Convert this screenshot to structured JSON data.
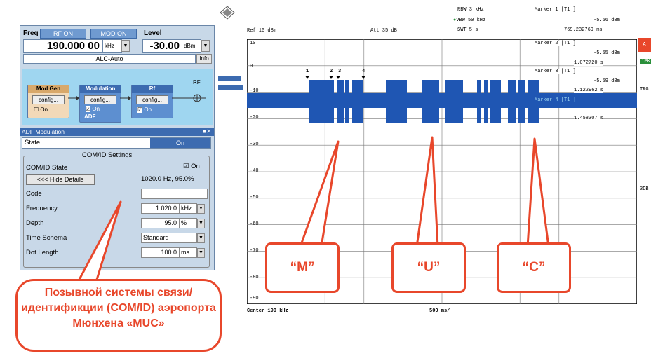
{
  "generator": {
    "freq_label": "Freq",
    "rf_on": "RF ON",
    "mod_on": "MOD ON",
    "level_label": "Level",
    "freq_value": "190.000 00",
    "freq_unit": "kHz",
    "level_value": "-30.00",
    "level_unit": "dBm",
    "alc": "ALC-Auto",
    "info": "Info",
    "blocks": [
      {
        "title": "Mod Gen",
        "btn": "config...",
        "check": "On"
      },
      {
        "title": "Modulation",
        "btn": "config...",
        "check": "On",
        "extra": "ADF"
      },
      {
        "title": "Rf",
        "btn": "config...",
        "check": "On"
      }
    ],
    "rf_out": "RF"
  },
  "adf": {
    "title": "ADF Modulation",
    "state_label": "State",
    "state_value": "On",
    "group_title": "COM/ID Settings",
    "comid_state_label": "COM/ID State",
    "comid_state_value": "On",
    "hide_details": "<<< Hide Details",
    "details_info": "1020.0 Hz, 95.0%",
    "code_label": "Code",
    "code_value": "",
    "freq_label": "Frequency",
    "freq_value": "1.020 0",
    "freq_unit": "kHz",
    "depth_label": "Depth",
    "depth_value": "95.0",
    "depth_unit": "%",
    "schema_label": "Time Schema",
    "schema_value": "Standard",
    "dot_label": "Dot Length",
    "dot_value": "100.0",
    "dot_unit": "ms"
  },
  "analyzer": {
    "rbw": "RBW  3 kHz",
    "vbw": "VBW  50 kHz",
    "swt": "SWT  5 s",
    "ref": "Ref   10 dBm",
    "att": "Att   35 dB",
    "marker1": "Marker 1 [T1 ]",
    "marker1_val": "-5.56 dBm",
    "marker1_pos": "769.232769 ms",
    "marker2": "Marker 2 [T1 ]",
    "marker2_val": "-5.55 dBm",
    "marker2_pos": "1.072720 s",
    "marker3": "Marker 3 [T1 ]",
    "marker3_val": "-5.59 dBm",
    "marker3_pos": "1.122962 s",
    "marker4": "Marker 4 [T1 ]",
    "marker4_pos": "1.458307 s",
    "y_ticks": [
      "10",
      "0",
      "-10",
      "-20",
      "-30",
      "-40",
      "-50",
      "-60",
      "-70",
      "-80",
      "-90"
    ],
    "marker_nums": [
      "1",
      "2",
      "3",
      "4"
    ],
    "center": "Center  190 kHz",
    "span": "500 ms/",
    "side_a": "A",
    "side_1pk": "1PK",
    "side_trg": "TRG",
    "side_3db": "3DB"
  },
  "callouts": {
    "m": "“M”",
    "u": "“U”",
    "c": "“C”",
    "caption": "Позывной системы связи/идентификции (COM/ID) аэропорта Мюнхена «MUC»"
  },
  "colors": {
    "trace": "#1f56b3",
    "accent": "#e8472b",
    "panel": "#9fd6f0"
  }
}
